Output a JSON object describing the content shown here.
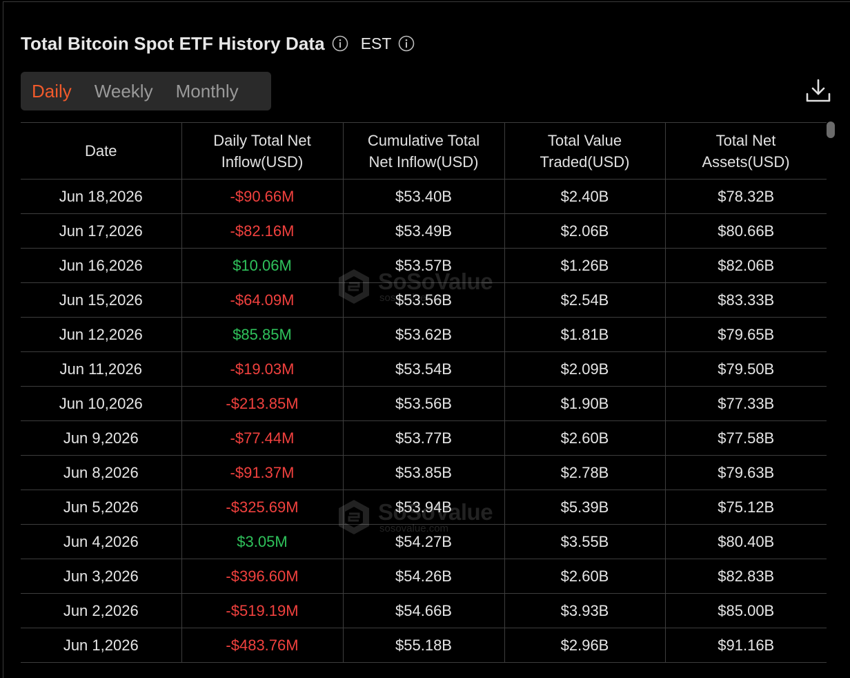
{
  "header": {
    "title": "Total Bitcoin Spot ETF History Data",
    "timezone": "EST"
  },
  "tabs": [
    {
      "label": "Daily",
      "active": true
    },
    {
      "label": "Weekly",
      "active": false
    },
    {
      "label": "Monthly",
      "active": false
    }
  ],
  "table": {
    "columns": [
      "Date",
      "Daily Total Net Inflow(USD)",
      "Cumulative Total Net Inflow(USD)",
      "Total Value Traded(USD)",
      "Total Net Assets(USD)"
    ],
    "column_lines": [
      [
        "Date"
      ],
      [
        "Daily Total Net",
        "Inflow(USD)"
      ],
      [
        "Cumulative Total",
        "Net Inflow(USD)"
      ],
      [
        "Total Value",
        "Traded(USD)"
      ],
      [
        "Total Net",
        "Assets(USD)"
      ]
    ],
    "rows": [
      {
        "date": "Jun 18,2026",
        "daily": "-$90.66M",
        "sign": "neg",
        "cumulative": "$53.40B",
        "traded": "$2.40B",
        "assets": "$78.32B"
      },
      {
        "date": "Jun 17,2026",
        "daily": "-$82.16M",
        "sign": "neg",
        "cumulative": "$53.49B",
        "traded": "$2.06B",
        "assets": "$80.66B"
      },
      {
        "date": "Jun 16,2026",
        "daily": "$10.06M",
        "sign": "pos",
        "cumulative": "$53.57B",
        "traded": "$1.26B",
        "assets": "$82.06B"
      },
      {
        "date": "Jun 15,2026",
        "daily": "-$64.09M",
        "sign": "neg",
        "cumulative": "$53.56B",
        "traded": "$2.54B",
        "assets": "$83.33B"
      },
      {
        "date": "Jun 12,2026",
        "daily": "$85.85M",
        "sign": "pos",
        "cumulative": "$53.62B",
        "traded": "$1.81B",
        "assets": "$79.65B"
      },
      {
        "date": "Jun 11,2026",
        "daily": "-$19.03M",
        "sign": "neg",
        "cumulative": "$53.54B",
        "traded": "$2.09B",
        "assets": "$79.50B"
      },
      {
        "date": "Jun 10,2026",
        "daily": "-$213.85M",
        "sign": "neg",
        "cumulative": "$53.56B",
        "traded": "$1.90B",
        "assets": "$77.33B"
      },
      {
        "date": "Jun 9,2026",
        "daily": "-$77.44M",
        "sign": "neg",
        "cumulative": "$53.77B",
        "traded": "$2.60B",
        "assets": "$77.58B"
      },
      {
        "date": "Jun 8,2026",
        "daily": "-$91.37M",
        "sign": "neg",
        "cumulative": "$53.85B",
        "traded": "$2.78B",
        "assets": "$79.63B"
      },
      {
        "date": "Jun 5,2026",
        "daily": "-$325.69M",
        "sign": "neg",
        "cumulative": "$53.94B",
        "traded": "$5.39B",
        "assets": "$75.12B"
      },
      {
        "date": "Jun 4,2026",
        "daily": "$3.05M",
        "sign": "pos",
        "cumulative": "$54.27B",
        "traded": "$3.55B",
        "assets": "$80.40B"
      },
      {
        "date": "Jun 3,2026",
        "daily": "-$396.60M",
        "sign": "neg",
        "cumulative": "$54.26B",
        "traded": "$2.60B",
        "assets": "$82.83B"
      },
      {
        "date": "Jun 2,2026",
        "daily": "-$519.19M",
        "sign": "neg",
        "cumulative": "$54.66B",
        "traded": "$3.93B",
        "assets": "$85.00B"
      },
      {
        "date": "Jun 1,2026",
        "daily": "-$483.76M",
        "sign": "neg",
        "cumulative": "$55.18B",
        "traded": "$2.96B",
        "assets": "$91.16B"
      }
    ]
  },
  "watermark": {
    "brand": "SoSoValue",
    "url": "sosovalue.com"
  },
  "icons": {
    "info": "info-icon",
    "download": "download-icon",
    "logo": "sosovalue-logo-icon"
  },
  "colors": {
    "accent": "#f15a2b",
    "negative": "#f0413e",
    "positive": "#2fc25b",
    "background": "#000000",
    "tab_bg": "#2a2a2a"
  }
}
